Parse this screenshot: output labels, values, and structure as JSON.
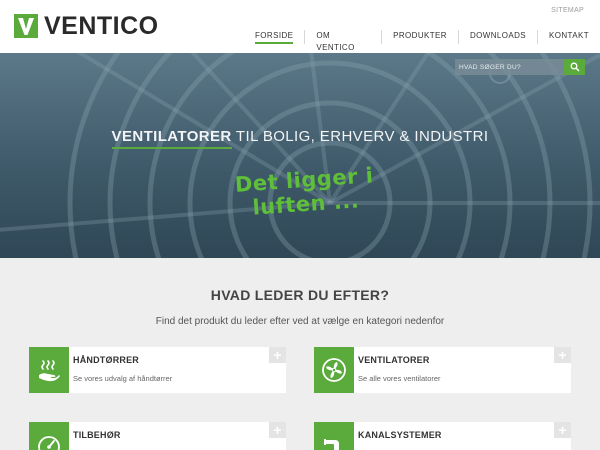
{
  "header": {
    "logo_text": "VENTICO",
    "sitemap": "SITEMAP",
    "nav": [
      {
        "label": "FORSIDE",
        "active": true
      },
      {
        "label": "OM VENTICO",
        "active": false
      },
      {
        "label": "PRODUKTER",
        "active": false
      },
      {
        "label": "DOWNLOADS",
        "active": false
      },
      {
        "label": "KONTAKT",
        "active": false
      }
    ]
  },
  "hero": {
    "search_placeholder": "HVAD SØGER DU?",
    "title_strong": "VENTILATORER",
    "title_rest": " TIL BOLIG, ERHVERV & INDUSTRI",
    "slogan": "Det ligger i luften ..."
  },
  "content": {
    "title": "HVAD LEDER DU EFTER?",
    "subtitle": "Find det produkt du leder efter ved at vælge en kategori nedenfor",
    "cards": [
      {
        "title": "HÅNDTØRRER",
        "desc": "Se vores udvalg af håndtørrer",
        "icon": "hand-dryer-icon"
      },
      {
        "title": "VENTILATORER",
        "desc": "Se alle vores ventilatorer",
        "icon": "fan-icon"
      },
      {
        "title": "TILBEHØR",
        "desc": "",
        "icon": "gauge-icon"
      },
      {
        "title": "KANALSYSTEMER",
        "desc": "",
        "icon": "duct-icon"
      }
    ]
  },
  "colors": {
    "accent": "#5aaa3c",
    "hero": "#4a6676"
  }
}
